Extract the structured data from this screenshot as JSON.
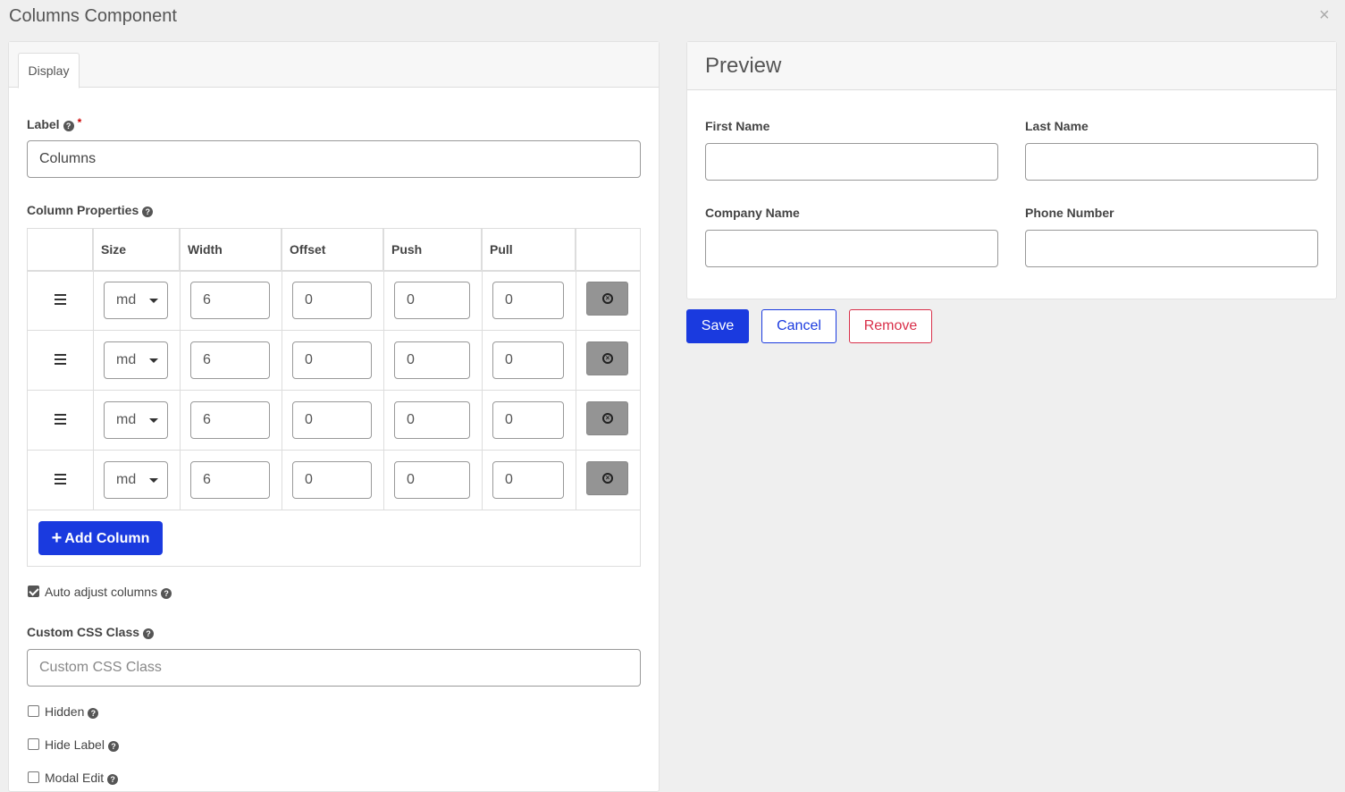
{
  "dialog": {
    "title": "Columns Component",
    "close_glyph": "×"
  },
  "tabs": [
    {
      "label": "Display",
      "active": true
    }
  ],
  "label_field": {
    "label": "Label",
    "required_mark": "*",
    "value": "Columns"
  },
  "column_properties": {
    "label": "Column Properties",
    "headers": [
      "",
      "Size",
      "Width",
      "Offset",
      "Push",
      "Pull",
      ""
    ],
    "rows": [
      {
        "size": "md",
        "width": "6",
        "offset": "0",
        "push": "0",
        "pull": "0"
      },
      {
        "size": "md",
        "width": "6",
        "offset": "0",
        "push": "0",
        "pull": "0"
      },
      {
        "size": "md",
        "width": "6",
        "offset": "0",
        "push": "0",
        "pull": "0"
      },
      {
        "size": "md",
        "width": "6",
        "offset": "0",
        "push": "0",
        "pull": "0"
      }
    ],
    "add_button": "Add Column"
  },
  "auto_adjust": {
    "label": "Auto adjust columns",
    "checked": true
  },
  "custom_css": {
    "label": "Custom CSS Class",
    "placeholder": "Custom CSS Class",
    "value": ""
  },
  "checkboxes": [
    {
      "label": "Hidden",
      "checked": false
    },
    {
      "label": "Hide Label",
      "checked": false
    },
    {
      "label": "Modal Edit",
      "checked": false
    }
  ],
  "preview": {
    "title": "Preview",
    "fields": [
      {
        "label": "First Name",
        "value": ""
      },
      {
        "label": "Last Name",
        "value": ""
      },
      {
        "label": "Company Name",
        "value": ""
      },
      {
        "label": "Phone Number",
        "value": ""
      }
    ]
  },
  "actions": {
    "save": "Save",
    "cancel": "Cancel",
    "remove": "Remove"
  },
  "colors": {
    "primary": "#1a3adf",
    "danger": "#d9304a",
    "muted_button": "#949494"
  },
  "icons": [
    "help-icon",
    "drag-handle-icon",
    "caret-down-icon",
    "remove-circle-icon",
    "plus-icon",
    "close-icon"
  ]
}
